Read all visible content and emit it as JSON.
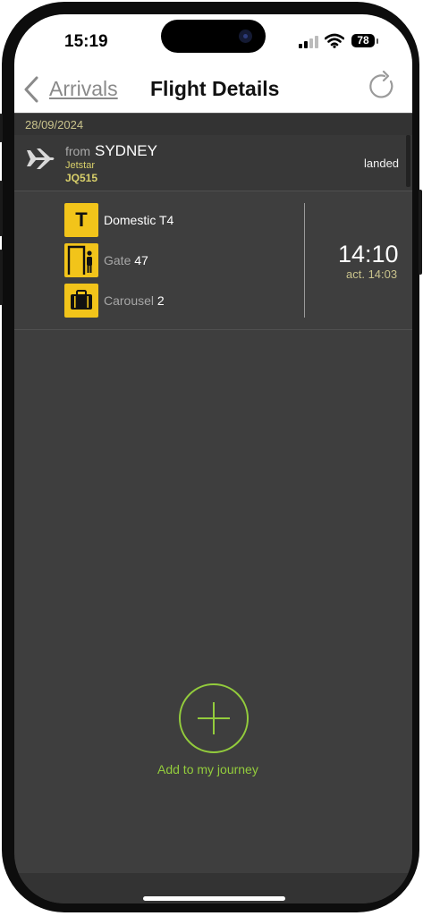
{
  "status_bar": {
    "time": "15:19",
    "battery": "78"
  },
  "nav": {
    "back_label": "Arrivals",
    "title": "Flight Details"
  },
  "date": "28/09/2024",
  "flight": {
    "from_label": "from",
    "city": "SYDNEY",
    "airline": "Jetstar",
    "flight_number": "JQ515",
    "status": "landed"
  },
  "details": {
    "terminal": {
      "badge": "T",
      "label": "Domestic T4"
    },
    "gate": {
      "label": "Gate",
      "value": "47"
    },
    "carousel": {
      "label": "Carousel",
      "value": "2"
    }
  },
  "times": {
    "scheduled": "14:10",
    "actual": "act. 14:03"
  },
  "journey": {
    "label": "Add to my journey"
  },
  "colors": {
    "accent_green": "#93cc3c",
    "badge_yellow": "#f2c41a",
    "text_yellow": "#d9d06a",
    "background": "#3e3e3e"
  },
  "icons": [
    "back-chevron-icon",
    "refresh-icon",
    "plane-icon",
    "terminal-icon",
    "gate-icon",
    "carousel-icon",
    "plus-icon",
    "signal-icon",
    "wifi-icon",
    "battery-icon"
  ]
}
